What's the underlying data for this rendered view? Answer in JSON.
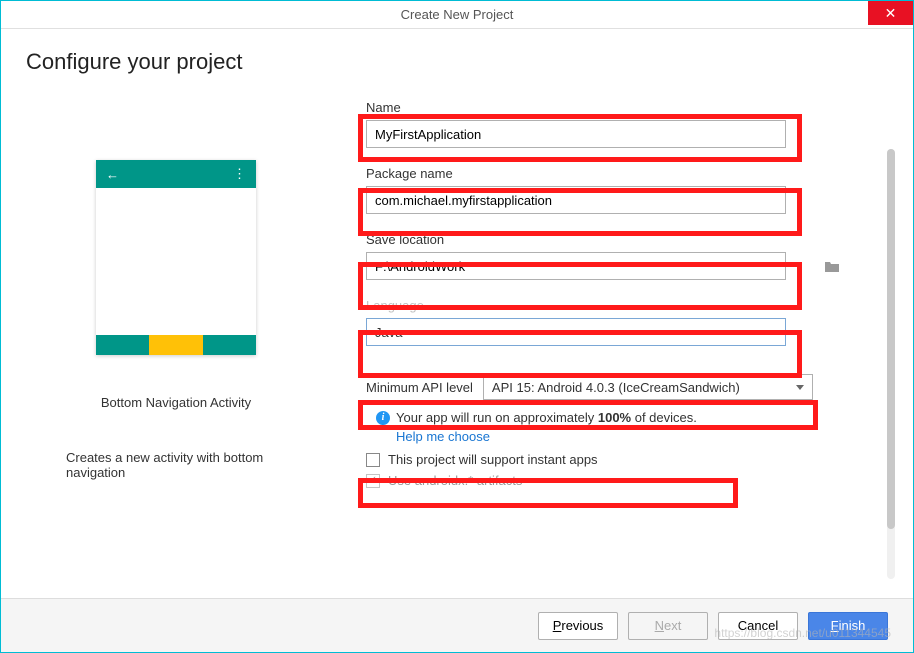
{
  "titlebar": {
    "title": "Create New Project"
  },
  "page": {
    "heading": "Configure your project"
  },
  "preview": {
    "label": "Bottom Navigation Activity",
    "description": "Creates a new activity with bottom navigation"
  },
  "form": {
    "name": {
      "label": "Name",
      "value": "MyFirstApplication"
    },
    "package": {
      "label": "Package name",
      "value": "com.michael.myfirstapplication"
    },
    "save_location": {
      "label": "Save location",
      "value": "F:\\AndroidWork"
    },
    "language": {
      "label": "Language",
      "value": "Java"
    },
    "api": {
      "label": "Minimum API level",
      "value": "API 15: Android 4.0.3 (IceCreamSandwich)"
    },
    "info_prefix": "Your app will run on approximately ",
    "info_pct": "100%",
    "info_suffix": " of devices.",
    "help_link": "Help me choose",
    "instant_apps": "This project will support instant apps",
    "androidx": "Use androidx.* artifacts"
  },
  "buttons": {
    "previous": "Previous",
    "next": "Next",
    "cancel": "Cancel",
    "finish": "Finish"
  },
  "watermark": "https://blog.csdn.net/u011344545"
}
